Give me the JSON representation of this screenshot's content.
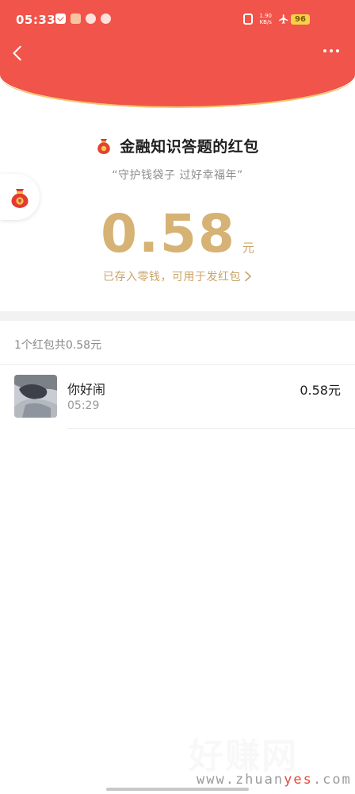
{
  "status_bar": {
    "time": "05:33",
    "net_speed_value": "1.90",
    "net_speed_unit": "KB/s",
    "battery": "96"
  },
  "envelope": {
    "title": "金融知识答题的红包",
    "subtitle": "“守护钱袋子 过好幸福年”",
    "amount": "0.58",
    "amount_unit": "元",
    "saved_note": "已存入零钱，可用于发红包"
  },
  "summary": "1个红包共0.58元",
  "records": [
    {
      "name": "你好闹",
      "time": "05:29",
      "amount": "0.58元"
    }
  ],
  "watermark": {
    "big": "好赚网",
    "small_prefix": "www.zhuan",
    "small_highlight": "yes",
    "small_suffix": ".com"
  },
  "colors": {
    "header_red": "#f0544a",
    "header_rim": "#f6c56a",
    "amount_gold": "#d6b274",
    "link_gold": "#c9a56a"
  }
}
